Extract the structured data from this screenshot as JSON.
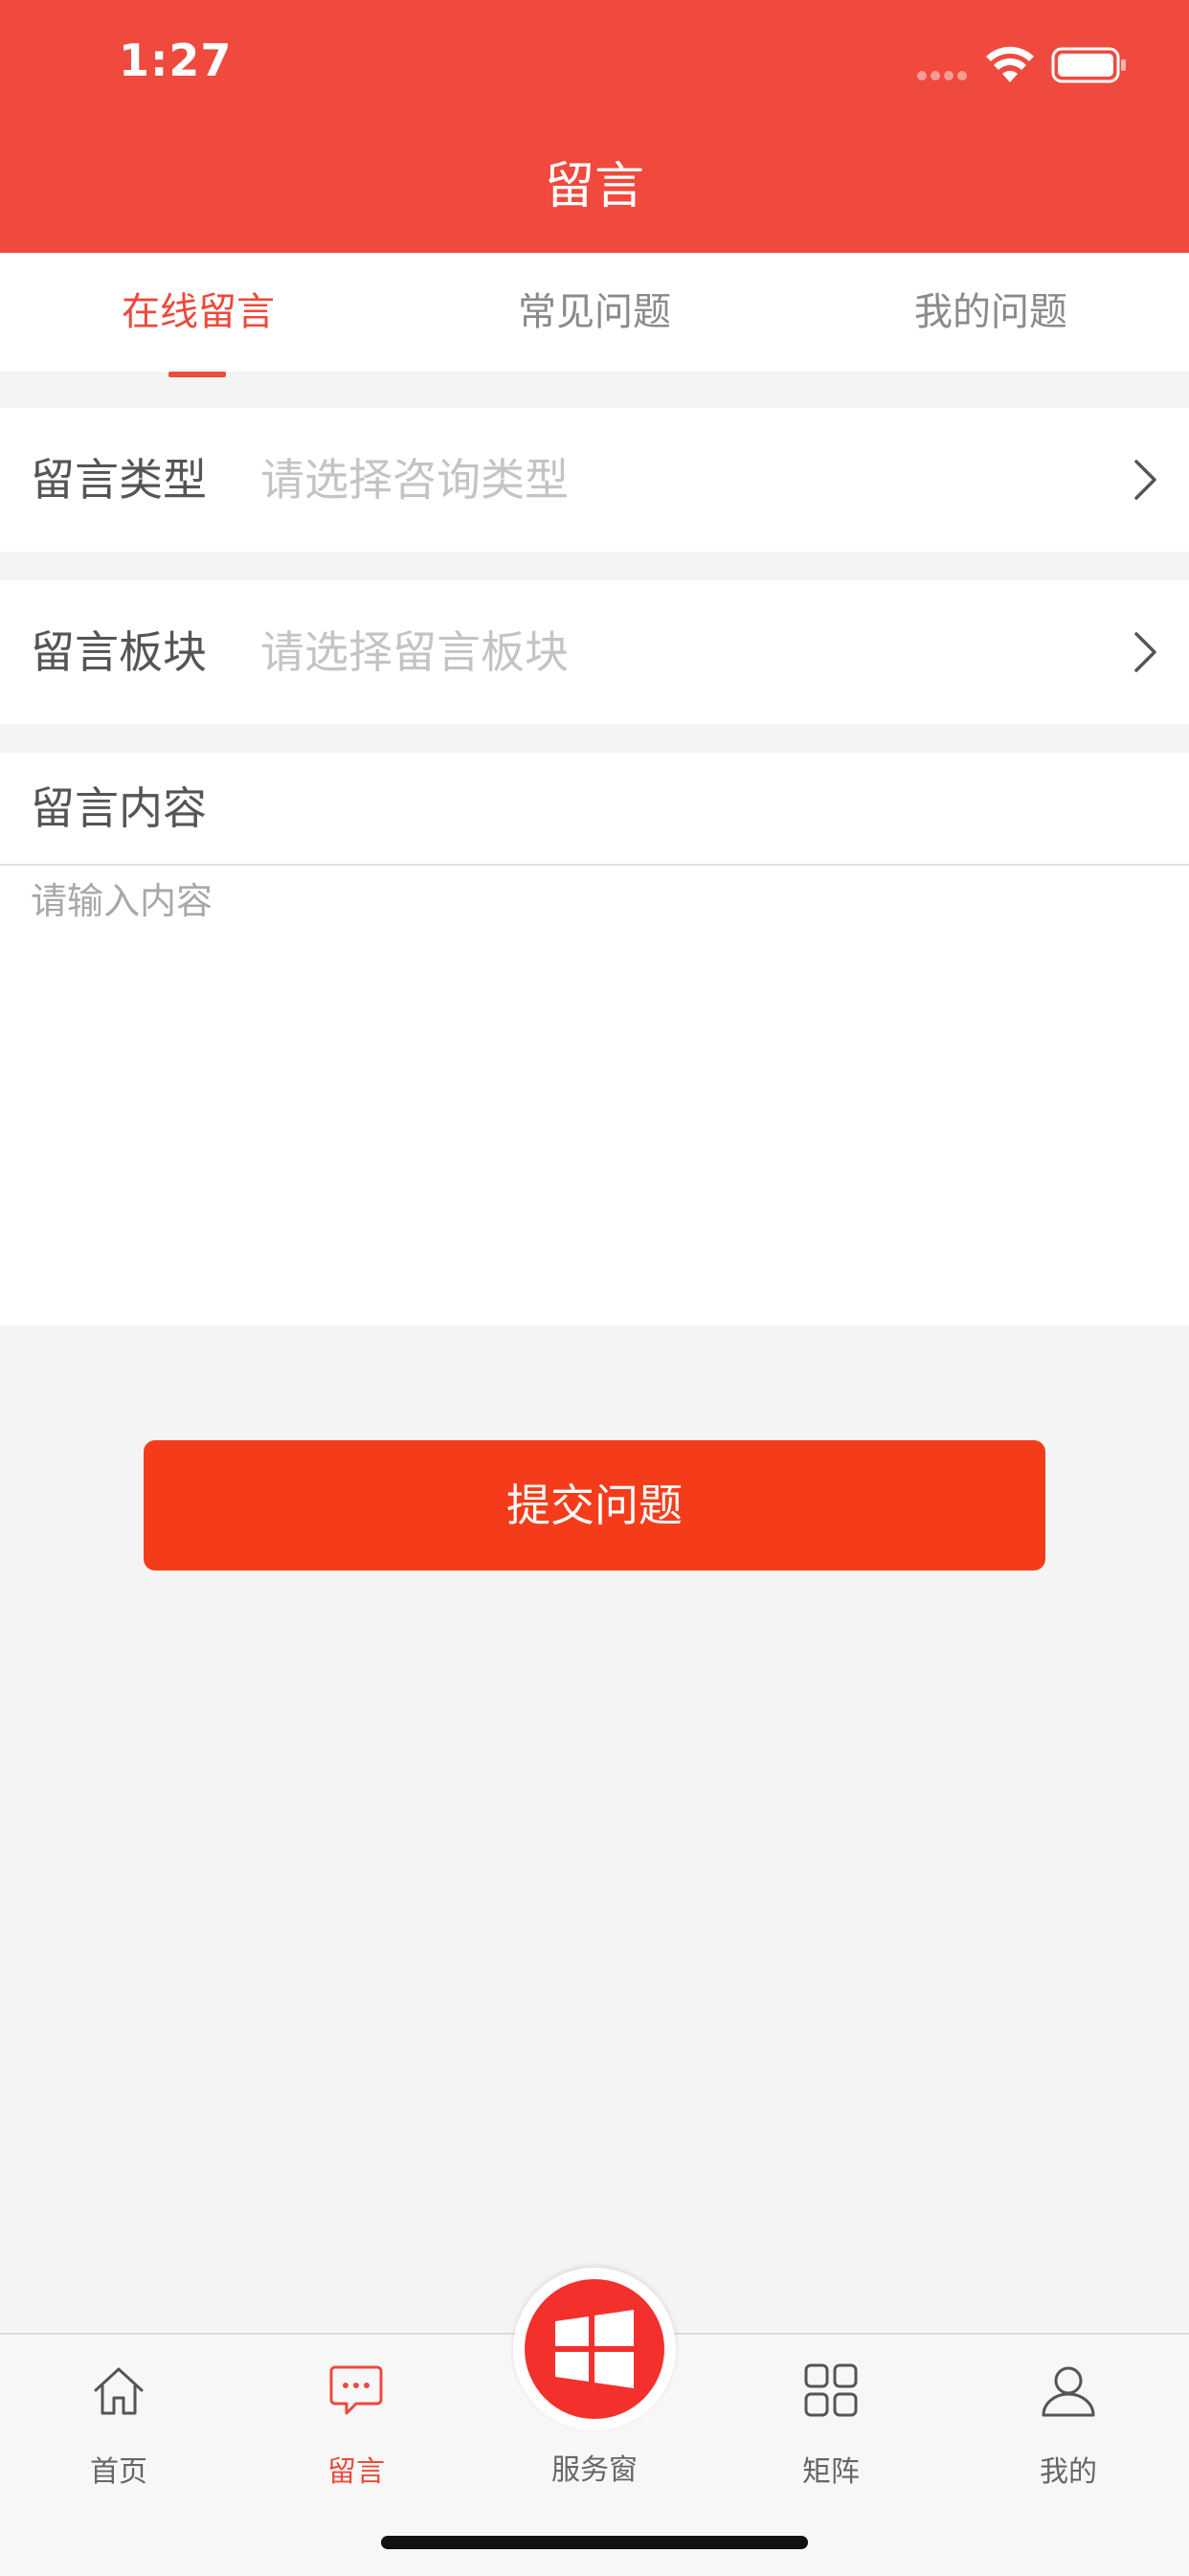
{
  "status_bar": {
    "time": "1:27"
  },
  "header": {
    "title": "留言"
  },
  "tabs": [
    {
      "label": "在线留言",
      "active": true
    },
    {
      "label": "常见问题",
      "active": false
    },
    {
      "label": "我的问题",
      "active": false
    }
  ],
  "form": {
    "type_label": "留言类型",
    "type_placeholder": "请选择咨询类型",
    "section_label": "留言板块",
    "section_placeholder": "请选择留言板块",
    "content_label": "留言内容",
    "content_placeholder": "请输入内容",
    "content_value": ""
  },
  "submit_label": "提交问题",
  "tabbar": {
    "items": [
      {
        "label": "首页",
        "icon": "home-icon",
        "active": false
      },
      {
        "label": "留言",
        "icon": "message-icon",
        "active": true
      },
      {
        "label": "服务窗",
        "icon": "windows-icon",
        "active": false
      },
      {
        "label": "矩阵",
        "icon": "grid-icon",
        "active": false
      },
      {
        "label": "我的",
        "icon": "user-icon",
        "active": false
      }
    ]
  },
  "colors": {
    "brand": "#f0493e",
    "accent_text": "#ec4a3c",
    "submit": "#f43c1b",
    "background": "#f4f4f4"
  }
}
